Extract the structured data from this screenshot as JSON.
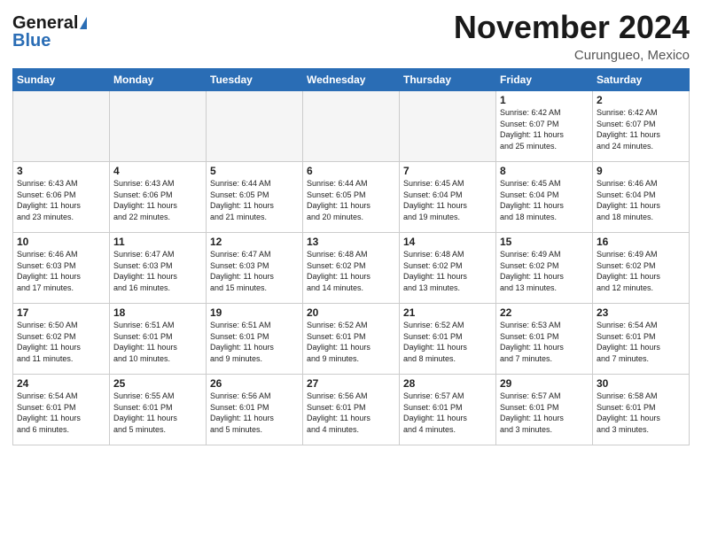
{
  "header": {
    "logo_general": "General",
    "logo_blue": "Blue",
    "month": "November 2024",
    "location": "Curungueo, Mexico"
  },
  "weekdays": [
    "Sunday",
    "Monday",
    "Tuesday",
    "Wednesday",
    "Thursday",
    "Friday",
    "Saturday"
  ],
  "weeks": [
    [
      {
        "day": "",
        "info": ""
      },
      {
        "day": "",
        "info": ""
      },
      {
        "day": "",
        "info": ""
      },
      {
        "day": "",
        "info": ""
      },
      {
        "day": "",
        "info": ""
      },
      {
        "day": "1",
        "info": "Sunrise: 6:42 AM\nSunset: 6:07 PM\nDaylight: 11 hours\nand 25 minutes."
      },
      {
        "day": "2",
        "info": "Sunrise: 6:42 AM\nSunset: 6:07 PM\nDaylight: 11 hours\nand 24 minutes."
      }
    ],
    [
      {
        "day": "3",
        "info": "Sunrise: 6:43 AM\nSunset: 6:06 PM\nDaylight: 11 hours\nand 23 minutes."
      },
      {
        "day": "4",
        "info": "Sunrise: 6:43 AM\nSunset: 6:06 PM\nDaylight: 11 hours\nand 22 minutes."
      },
      {
        "day": "5",
        "info": "Sunrise: 6:44 AM\nSunset: 6:05 PM\nDaylight: 11 hours\nand 21 minutes."
      },
      {
        "day": "6",
        "info": "Sunrise: 6:44 AM\nSunset: 6:05 PM\nDaylight: 11 hours\nand 20 minutes."
      },
      {
        "day": "7",
        "info": "Sunrise: 6:45 AM\nSunset: 6:04 PM\nDaylight: 11 hours\nand 19 minutes."
      },
      {
        "day": "8",
        "info": "Sunrise: 6:45 AM\nSunset: 6:04 PM\nDaylight: 11 hours\nand 18 minutes."
      },
      {
        "day": "9",
        "info": "Sunrise: 6:46 AM\nSunset: 6:04 PM\nDaylight: 11 hours\nand 18 minutes."
      }
    ],
    [
      {
        "day": "10",
        "info": "Sunrise: 6:46 AM\nSunset: 6:03 PM\nDaylight: 11 hours\nand 17 minutes."
      },
      {
        "day": "11",
        "info": "Sunrise: 6:47 AM\nSunset: 6:03 PM\nDaylight: 11 hours\nand 16 minutes."
      },
      {
        "day": "12",
        "info": "Sunrise: 6:47 AM\nSunset: 6:03 PM\nDaylight: 11 hours\nand 15 minutes."
      },
      {
        "day": "13",
        "info": "Sunrise: 6:48 AM\nSunset: 6:02 PM\nDaylight: 11 hours\nand 14 minutes."
      },
      {
        "day": "14",
        "info": "Sunrise: 6:48 AM\nSunset: 6:02 PM\nDaylight: 11 hours\nand 13 minutes."
      },
      {
        "day": "15",
        "info": "Sunrise: 6:49 AM\nSunset: 6:02 PM\nDaylight: 11 hours\nand 13 minutes."
      },
      {
        "day": "16",
        "info": "Sunrise: 6:49 AM\nSunset: 6:02 PM\nDaylight: 11 hours\nand 12 minutes."
      }
    ],
    [
      {
        "day": "17",
        "info": "Sunrise: 6:50 AM\nSunset: 6:02 PM\nDaylight: 11 hours\nand 11 minutes."
      },
      {
        "day": "18",
        "info": "Sunrise: 6:51 AM\nSunset: 6:01 PM\nDaylight: 11 hours\nand 10 minutes."
      },
      {
        "day": "19",
        "info": "Sunrise: 6:51 AM\nSunset: 6:01 PM\nDaylight: 11 hours\nand 9 minutes."
      },
      {
        "day": "20",
        "info": "Sunrise: 6:52 AM\nSunset: 6:01 PM\nDaylight: 11 hours\nand 9 minutes."
      },
      {
        "day": "21",
        "info": "Sunrise: 6:52 AM\nSunset: 6:01 PM\nDaylight: 11 hours\nand 8 minutes."
      },
      {
        "day": "22",
        "info": "Sunrise: 6:53 AM\nSunset: 6:01 PM\nDaylight: 11 hours\nand 7 minutes."
      },
      {
        "day": "23",
        "info": "Sunrise: 6:54 AM\nSunset: 6:01 PM\nDaylight: 11 hours\nand 7 minutes."
      }
    ],
    [
      {
        "day": "24",
        "info": "Sunrise: 6:54 AM\nSunset: 6:01 PM\nDaylight: 11 hours\nand 6 minutes."
      },
      {
        "day": "25",
        "info": "Sunrise: 6:55 AM\nSunset: 6:01 PM\nDaylight: 11 hours\nand 5 minutes."
      },
      {
        "day": "26",
        "info": "Sunrise: 6:56 AM\nSunset: 6:01 PM\nDaylight: 11 hours\nand 5 minutes."
      },
      {
        "day": "27",
        "info": "Sunrise: 6:56 AM\nSunset: 6:01 PM\nDaylight: 11 hours\nand 4 minutes."
      },
      {
        "day": "28",
        "info": "Sunrise: 6:57 AM\nSunset: 6:01 PM\nDaylight: 11 hours\nand 4 minutes."
      },
      {
        "day": "29",
        "info": "Sunrise: 6:57 AM\nSunset: 6:01 PM\nDaylight: 11 hours\nand 3 minutes."
      },
      {
        "day": "30",
        "info": "Sunrise: 6:58 AM\nSunset: 6:01 PM\nDaylight: 11 hours\nand 3 minutes."
      }
    ]
  ]
}
